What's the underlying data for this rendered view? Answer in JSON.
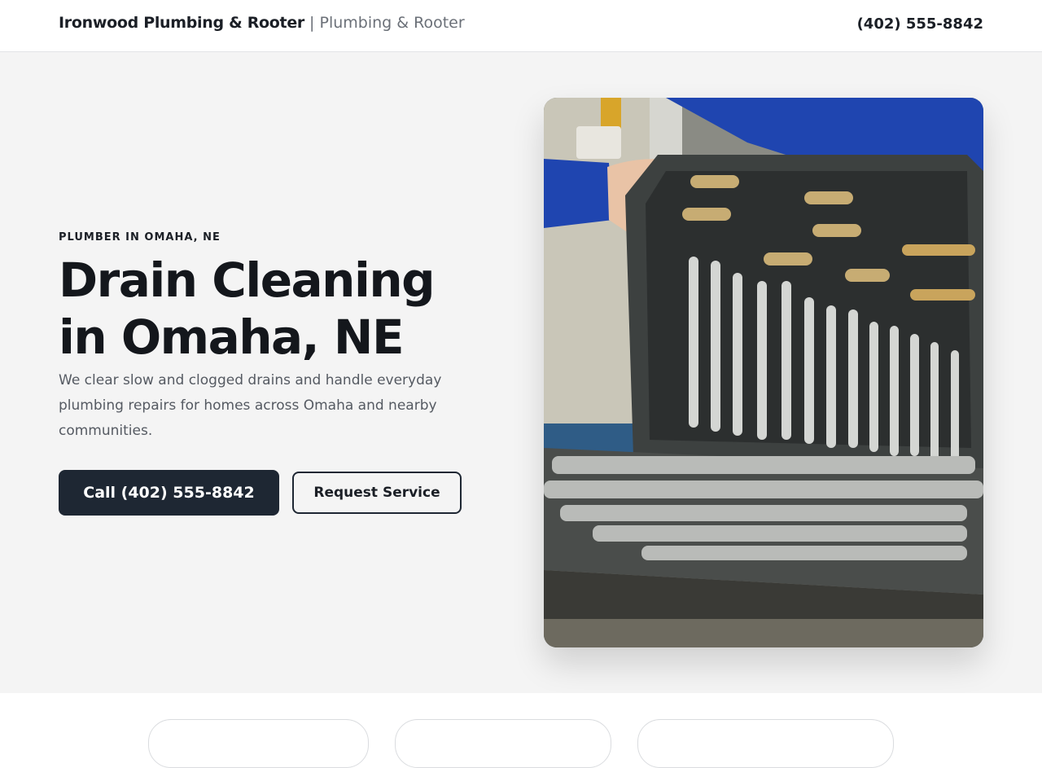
{
  "header": {
    "brand_name": "Ironwood Plumbing & Rooter",
    "separator": "|",
    "brand_tagline": "Plumbing & Rooter",
    "phone": "(402) 555-8842"
  },
  "hero": {
    "eyebrow": "PLUMBER IN OMAHA, NE",
    "headline": "Drain Cleaning in Omaha, NE",
    "lede": "We clear slow and clogged drains and handle everyday plumbing repairs for homes across Omaha and nearby communities.",
    "primary_cta": "Call (402) 555-8842",
    "secondary_cta": "Request Service",
    "image_icon": "toolbox-photo"
  },
  "colors": {
    "accent_dark": "#1e2733",
    "hero_background": "#f4f4f4",
    "text_muted": "#555a62"
  }
}
